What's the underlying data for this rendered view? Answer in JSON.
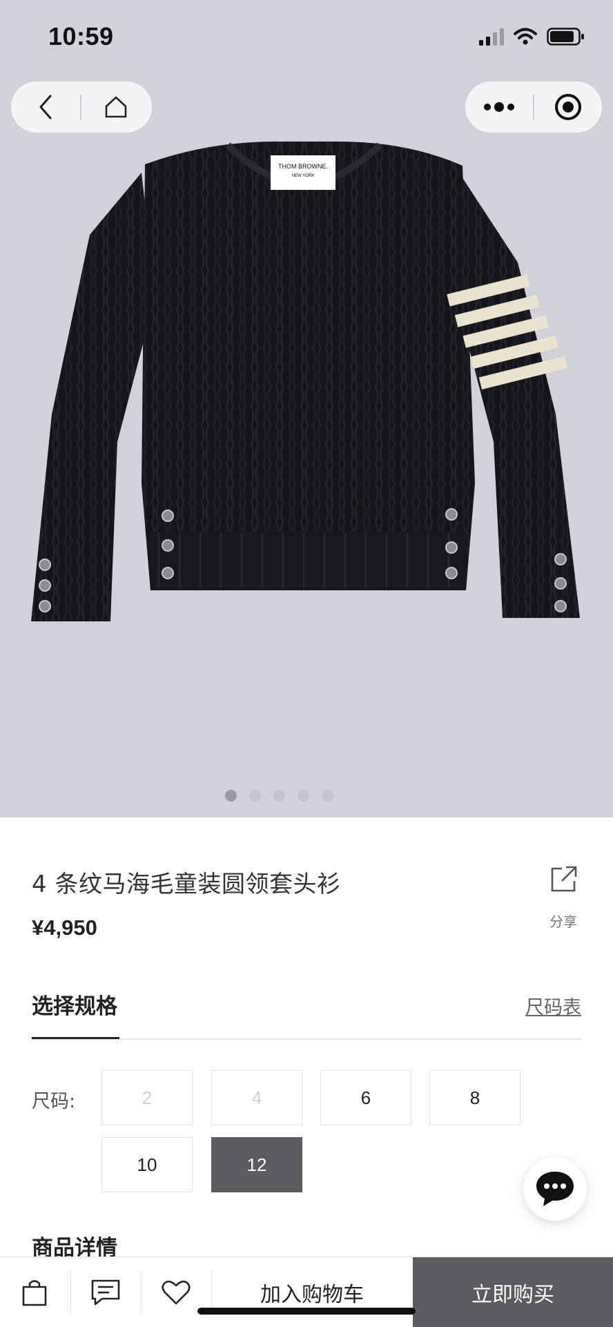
{
  "status_bar": {
    "time": "10:59"
  },
  "nav": {
    "back_icon": "chevron-left-icon",
    "home_icon": "home-icon",
    "more_icon": "more-dots-icon",
    "close_icon": "target-close-icon"
  },
  "hero": {
    "label_brand": "THOM BROWNE.",
    "label_city": "NEW YORK",
    "dots": 5,
    "active_dot": 0
  },
  "product": {
    "title": "4 条纹马海毛童装圆领套头衫",
    "price": "¥4,950",
    "share_label": "分享"
  },
  "spec": {
    "heading": "选择规格",
    "size_chart_link": "尺码表",
    "size_label": "尺码:",
    "sizes": [
      {
        "label": "2",
        "state": "disabled"
      },
      {
        "label": "4",
        "state": "disabled"
      },
      {
        "label": "6",
        "state": "available"
      },
      {
        "label": "8",
        "state": "available"
      },
      {
        "label": "10",
        "state": "available"
      },
      {
        "label": "12",
        "state": "selected"
      }
    ]
  },
  "details": {
    "heading": "商品详情"
  },
  "bottom_bar": {
    "icons": [
      "bag-icon",
      "message-icon",
      "heart-icon"
    ],
    "add_to_cart": "加入购物车",
    "buy_now": "立即购买"
  },
  "colors": {
    "background": "#d1d1d9",
    "accent": "#5b5b60",
    "sweater": "#15151c",
    "stripe": "#e8e2cf"
  }
}
